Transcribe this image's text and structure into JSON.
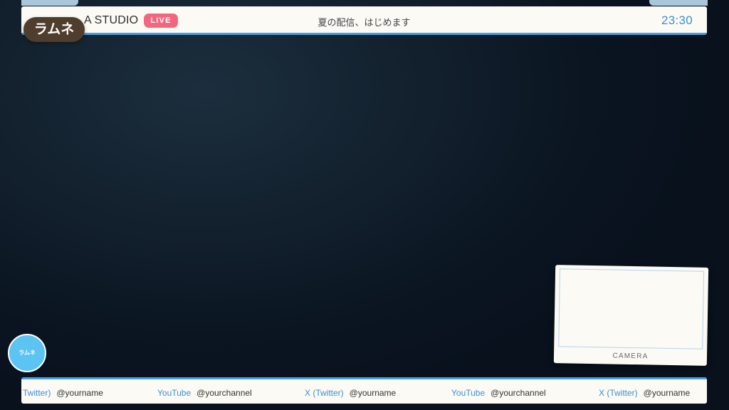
{
  "header": {
    "studio_name": "A STUDIO",
    "live_badge": "LIVE",
    "stream_title": "夏の配信、はじめます",
    "clock": "23:30"
  },
  "brand": {
    "logo_text": "ラムネ",
    "avatar_text": "ラムネ"
  },
  "camera": {
    "label": "CAMERA"
  },
  "social": {
    "items": [
      {
        "platform": "Twitter)",
        "handle": "@yourname"
      },
      {
        "platform": "YouTube",
        "handle": "@yourchannel"
      },
      {
        "platform": "X (Twitter)",
        "handle": "@yourname"
      },
      {
        "platform": "YouTube",
        "handle": "@yourchannel"
      },
      {
        "platform": "X (Twitter)",
        "handle": "@yourname"
      }
    ]
  },
  "colors": {
    "accent_blue": "#3b8fd6",
    "live_pink": "#f2667e",
    "logo_brown": "#4f3d2d",
    "avatar_cyan": "#5bc4f2",
    "panel_cream": "#fbfaf5",
    "background_navy": "#0b1522"
  }
}
